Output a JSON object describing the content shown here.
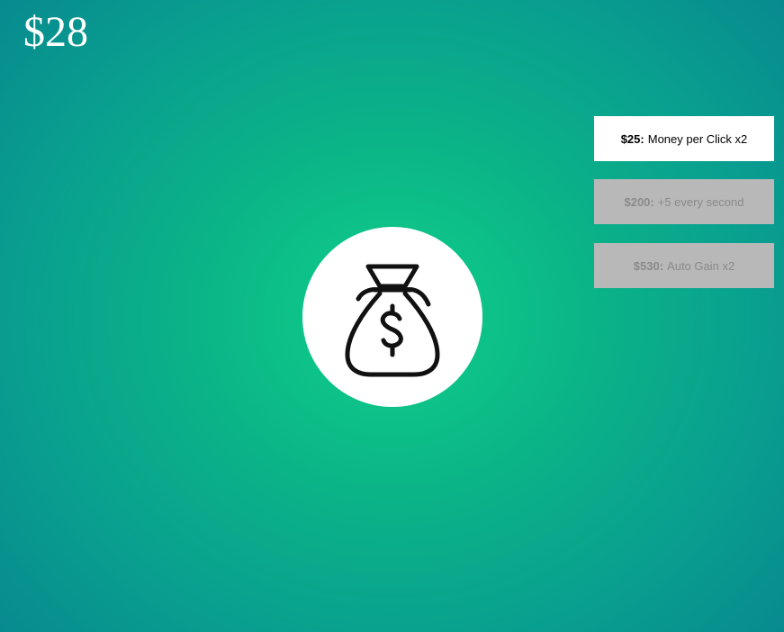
{
  "money": "$28",
  "upgrades": [
    {
      "price": "$25:",
      "label": "Money per Click x2",
      "state": "available"
    },
    {
      "price": "$200:",
      "label": "+5 every second",
      "state": "locked"
    },
    {
      "price": "$530:",
      "label": "Auto Gain x2",
      "state": "locked"
    }
  ],
  "icons": {
    "click_target": "money-bag-icon"
  },
  "colors": {
    "background_center": "#0fd088",
    "background_edge": "#08868f",
    "upgrade_available_bg": "#ffffff",
    "upgrade_locked_bg": "#b8b8b8",
    "upgrade_locked_text": "#8a8a8a"
  }
}
